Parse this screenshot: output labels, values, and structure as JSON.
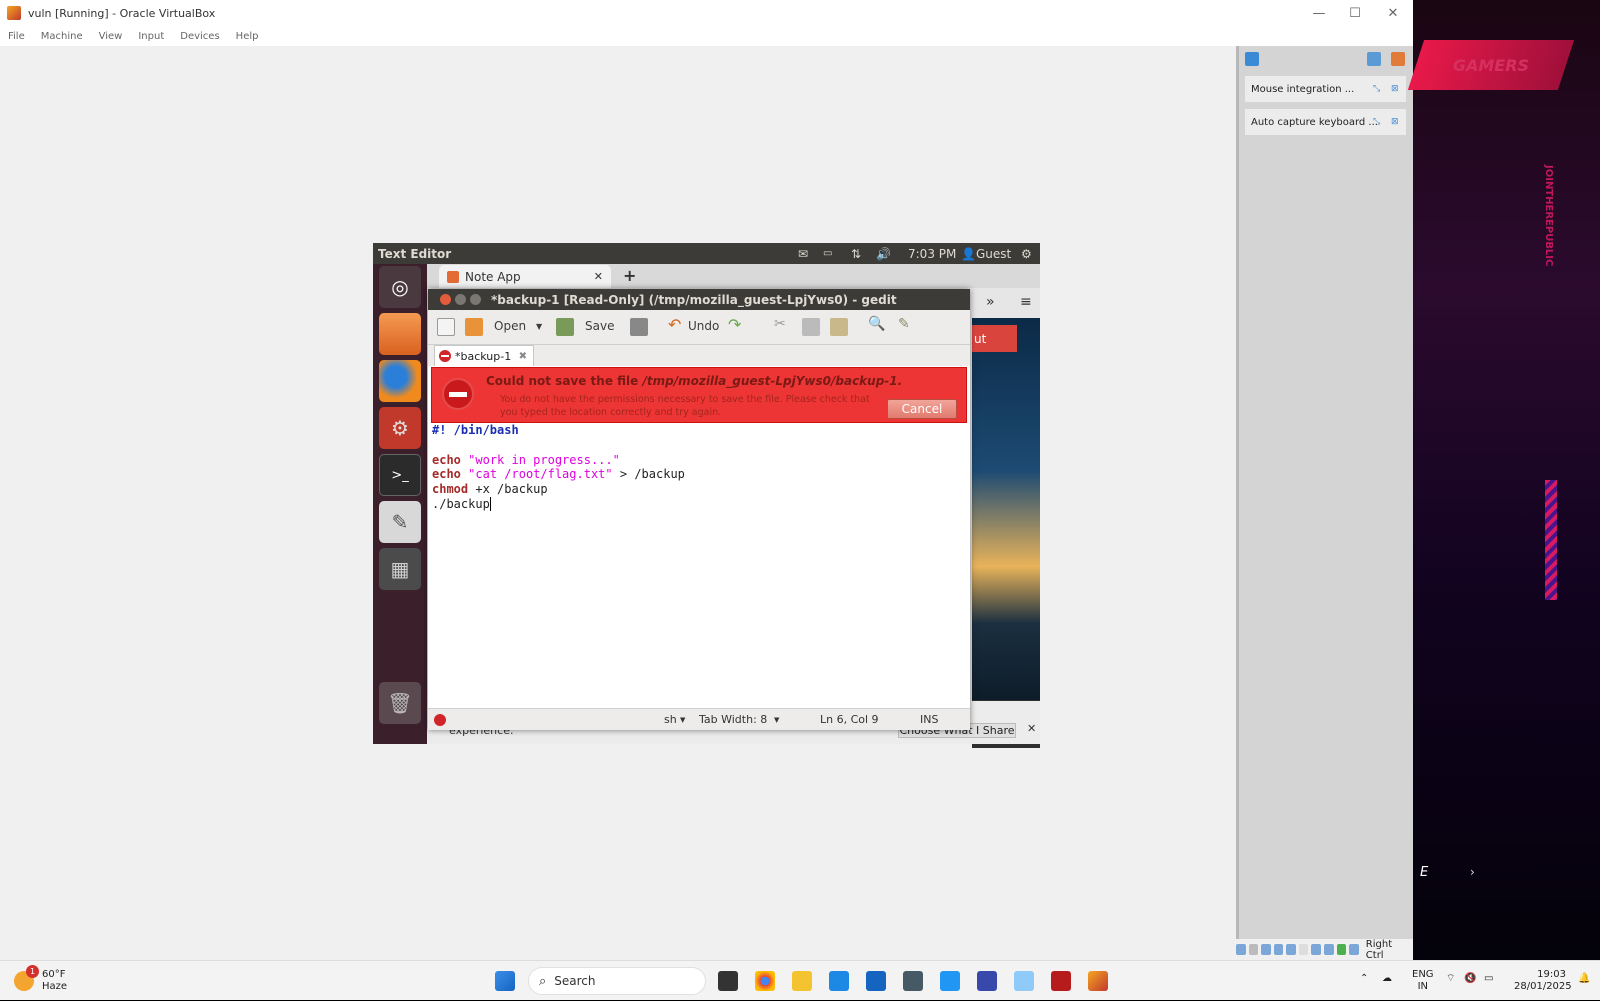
{
  "host": {
    "window_title": "vuln [Running] - Oracle VirtualBox",
    "menu": [
      "File",
      "Machine",
      "View",
      "Input",
      "Devices",
      "Help"
    ],
    "notifications": [
      {
        "label": "Mouse integration ..."
      },
      {
        "label": "Auto capture keyboard ..."
      }
    ],
    "host_key": "Right Ctrl"
  },
  "wallpaper": {
    "banner": "GAMERS",
    "vertical_text": "JOINTHEREPUBLIC",
    "letter": "E"
  },
  "ubuntu": {
    "app_title": "Text Editor",
    "clock": "7:03 PM",
    "user": "Guest"
  },
  "firefox": {
    "tab_label": "Note App",
    "web_button": "ut",
    "bottom_text": "experience.",
    "choose_button": "Choose What I Share"
  },
  "gedit": {
    "title": "*backup-1 [Read-Only] (/tmp/mozilla_guest-LpjYws0) - gedit",
    "toolbar": {
      "open": "Open",
      "save": "Save",
      "undo": "Undo"
    },
    "doc_tab": "*backup-1",
    "error": {
      "heading_prefix": "Could not save the file ",
      "heading_path": "/tmp/mozilla_guest-LpjYws0/backup-1.",
      "message": "You do not have the permissions necessary to save the file. Please check that you typed the location correctly and try again.",
      "cancel": "Cancel"
    },
    "code": {
      "line1": "#! /bin/bash",
      "line3_kw": "echo",
      "line3_str": "\"work in progress...\"",
      "line4_kw": "echo",
      "line4_str": "\"cat /root/flag.txt\"",
      "line4_rest": " > /backup",
      "line5_kw": "chmod",
      "line5_rest": " +x /backup",
      "line6": "./backup"
    },
    "status": {
      "lang": "sh",
      "tab_width": "Tab Width: 8",
      "position": "Ln 6, Col 9",
      "mode": "INS"
    }
  },
  "taskbar": {
    "weather_temp": "60°F",
    "weather_desc": "Haze",
    "weather_badge": "1",
    "search_placeholder": "Search",
    "lang_top": "ENG",
    "lang_bottom": "IN",
    "time": "19:03",
    "date": "28/01/2025"
  }
}
